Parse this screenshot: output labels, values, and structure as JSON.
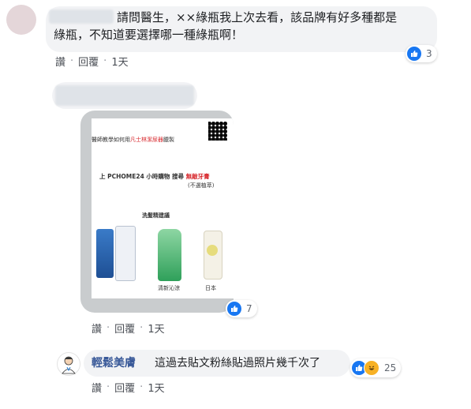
{
  "comment1": {
    "text_line1": "請問醫生，××綠瓶我上次去看，該品牌有好多種都是",
    "text_line2": "綠瓶，不知道要選擇哪一種綠瓶啊！",
    "actions": {
      "like": "讚",
      "reply": "回覆",
      "time": "1天"
    },
    "reaction_count": "3"
  },
  "comment2": {
    "poster": {
      "line1_prefix": "醫師教學如何用",
      "line1_highlight": "凡士林潔尿器",
      "line1_suffix": "臘製",
      "line2_prefix": "上 PCHOME24 小時購物  搜尋",
      "line2_highlight": "無敵牙膏",
      "line3": "(不選植萃)",
      "section_title": "洗髮精建議",
      "label_mid": "清新沁涼",
      "label_right": "日本"
    },
    "actions": {
      "like": "讚",
      "reply": "回覆",
      "time": "1天"
    },
    "reaction_count": "7"
  },
  "reply": {
    "author": "輕鬆美膚",
    "text": "這過去貼文粉絲貼過照片幾千次了",
    "actions": {
      "like": "讚",
      "reply": "回覆",
      "time": "1天"
    },
    "reaction_count": "25"
  },
  "colors": {
    "like_blue": "#1877f2",
    "haha_yellow": "#f7b125",
    "author_blue": "#385898",
    "poster_red": "#d7262b"
  }
}
